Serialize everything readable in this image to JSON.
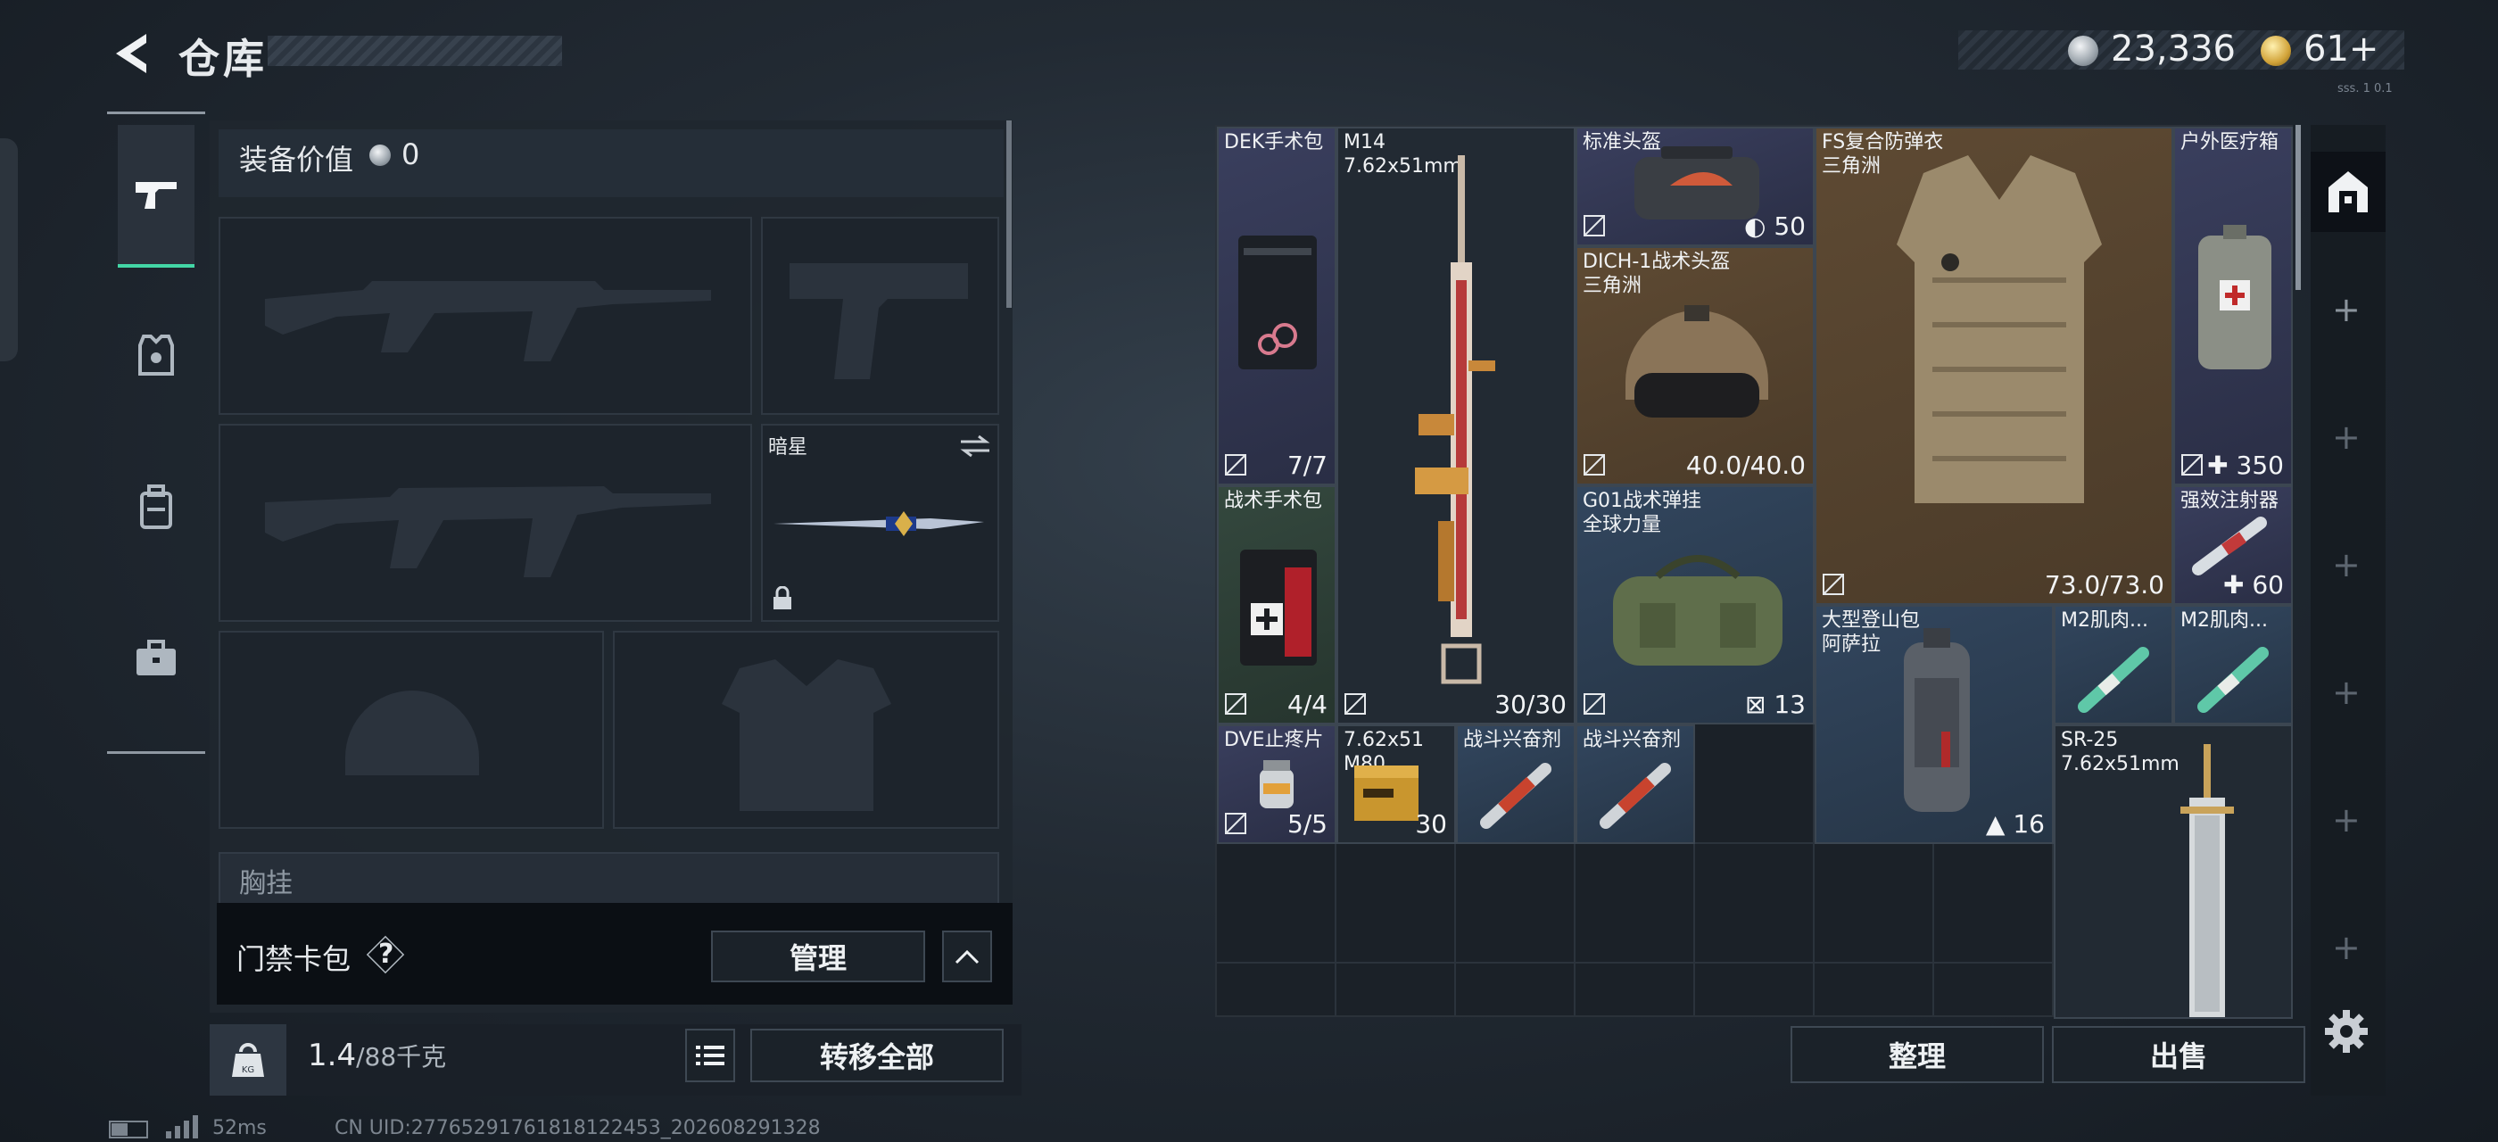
{
  "header": {
    "title": "仓库",
    "currency_silver": "23,336",
    "currency_gold": "61+",
    "version": "sss. 1 0.1"
  },
  "loadout": {
    "equip_value_label": "装备价值",
    "equip_value": "0",
    "melee_name": "暗星",
    "chest_label": "胸挂",
    "keycard_label": "门禁卡包",
    "keycard_help": "?",
    "manage_label": "管理",
    "weight_current": "1.4",
    "weight_capacity": "/88千克",
    "transfer_all_label": "转移全部"
  },
  "storage": {
    "items": [
      {
        "name": "DEK手术包",
        "sub": "",
        "qty": "7/7"
      },
      {
        "name": "M14",
        "sub": "7.62x51mm",
        "qty": "30/30"
      },
      {
        "name": "标准头盔",
        "sub": "",
        "qty": "50"
      },
      {
        "name": "FS复合防弹衣",
        "sub": "三角洲",
        "qty": "73.0/73.0"
      },
      {
        "name": "户外医疗箱",
        "sub": "",
        "qty": "350"
      },
      {
        "name": "DICH-1战术头盔",
        "sub": "三角洲",
        "qty": "40.0/40.0"
      },
      {
        "name": "战术手术包",
        "sub": "",
        "qty": "4/4"
      },
      {
        "name": "G01战术弹挂",
        "sub": "全球力量",
        "qty": "13"
      },
      {
        "name": "强效注射器",
        "sub": "",
        "qty": "60"
      },
      {
        "name": "大型登山包",
        "sub": "阿萨拉",
        "qty": "16"
      },
      {
        "name": "M2肌肉...",
        "sub": "",
        "qty": ""
      },
      {
        "name": "M2肌肉...",
        "sub": "",
        "qty": ""
      },
      {
        "name": "DVE止疼片",
        "sub": "",
        "qty": "5/5"
      },
      {
        "name": "7.62x51",
        "sub": "M80",
        "qty": "30"
      },
      {
        "name": "战斗兴奋剂",
        "sub": "",
        "qty": ""
      },
      {
        "name": "战斗兴奋剂",
        "sub": "",
        "qty": ""
      },
      {
        "name": "SR-25",
        "sub": "7.62x51mm",
        "qty": ""
      }
    ],
    "sort_label": "整理",
    "sell_label": "出售"
  },
  "status_bar": {
    "ping": "52ms",
    "uid": "CN UID:27765291761818122453_202608291328"
  },
  "colors": {
    "accent_green": "#43d6a6",
    "quality_purple": "#3a3f5e",
    "quality_blue": "#32465e",
    "quality_gold": "#5e4a33",
    "quality_green": "#34483e"
  }
}
